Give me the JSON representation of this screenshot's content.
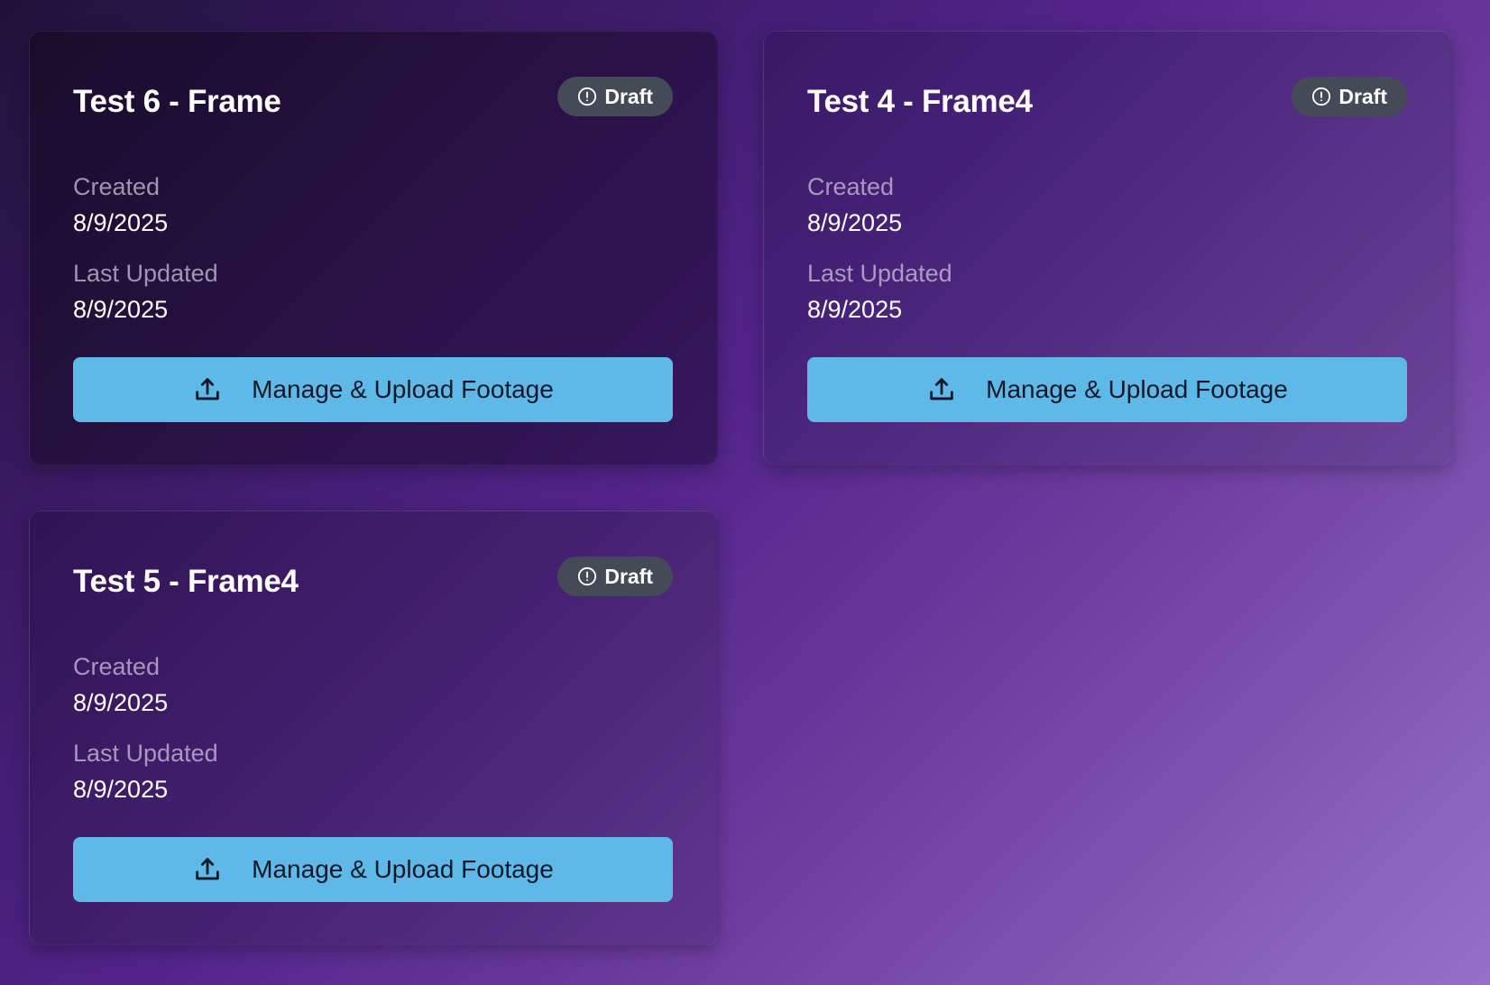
{
  "cards": [
    {
      "title": "Test 6 - Frame",
      "status": "Draft",
      "created_label": "Created",
      "created_value": "8/9/2025",
      "updated_label": "Last Updated",
      "updated_value": "8/9/2025",
      "action_label": "Manage & Upload Footage"
    },
    {
      "title": "Test 4 - Frame4",
      "status": "Draft",
      "created_label": "Created",
      "created_value": "8/9/2025",
      "updated_label": "Last Updated",
      "updated_value": "8/9/2025",
      "action_label": "Manage & Upload Footage"
    },
    {
      "title": "Test 5 - Frame4",
      "status": "Draft",
      "created_label": "Created",
      "created_value": "8/9/2025",
      "updated_label": "Last Updated",
      "updated_value": "8/9/2025",
      "action_label": "Manage & Upload Footage"
    }
  ],
  "icons": {
    "status": "alert-circle-icon",
    "action": "upload-icon"
  },
  "colors": {
    "button": "#5fb9e8",
    "badge": "#454a57",
    "button_text": "#101828"
  }
}
